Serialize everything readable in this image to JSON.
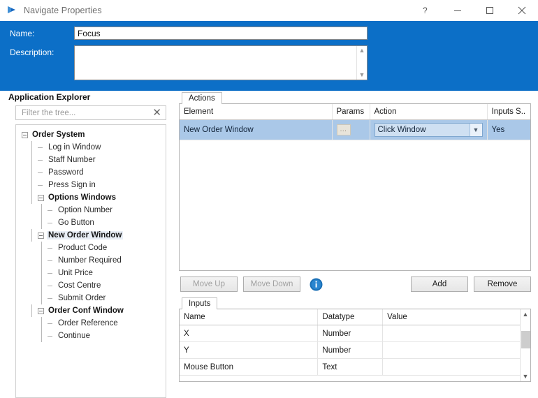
{
  "window": {
    "title": "Navigate Properties",
    "logo_icon": "play-triangle-icon",
    "controls": [
      {
        "name": "help",
        "glyph": "?"
      },
      {
        "name": "minimize",
        "glyph": "—"
      },
      {
        "name": "maximize",
        "glyph": "□"
      },
      {
        "name": "close",
        "glyph": "×"
      }
    ],
    "header_color": "#0c6fc7"
  },
  "form": {
    "name_label": "Name:",
    "name_value": "Focus",
    "description_label": "Description:",
    "description_value": "",
    "description_placeholder": ""
  },
  "explorer": {
    "title": "Application Explorer",
    "filter_placeholder": "Filter the tree...",
    "filter_value": "",
    "clear_icon": "✕",
    "tree": [
      {
        "label": "Order System",
        "depth": 0,
        "expander": true,
        "bold": true,
        "highlight": false
      },
      {
        "label": "Log in Window",
        "depth": 1,
        "expander": false,
        "bold": false,
        "highlight": false
      },
      {
        "label": "Staff Number",
        "depth": 1,
        "expander": false,
        "bold": false,
        "highlight": false
      },
      {
        "label": "Password",
        "depth": 1,
        "expander": false,
        "bold": false,
        "highlight": false
      },
      {
        "label": "Press Sign in",
        "depth": 1,
        "expander": false,
        "bold": false,
        "highlight": false
      },
      {
        "label": "Options Windows",
        "depth": 1,
        "expander": true,
        "bold": true,
        "highlight": false
      },
      {
        "label": "Option Number",
        "depth": 2,
        "expander": false,
        "bold": false,
        "highlight": false
      },
      {
        "label": "Go Button",
        "depth": 2,
        "expander": false,
        "bold": false,
        "highlight": false
      },
      {
        "label": "New Order Window",
        "depth": 1,
        "expander": true,
        "bold": true,
        "highlight": true
      },
      {
        "label": "Product Code",
        "depth": 2,
        "expander": false,
        "bold": false,
        "highlight": false
      },
      {
        "label": "Number Required",
        "depth": 2,
        "expander": false,
        "bold": false,
        "highlight": false
      },
      {
        "label": "Unit Price",
        "depth": 2,
        "expander": false,
        "bold": false,
        "highlight": false
      },
      {
        "label": "Cost Centre",
        "depth": 2,
        "expander": false,
        "bold": false,
        "highlight": false
      },
      {
        "label": "Submit Order",
        "depth": 2,
        "expander": false,
        "bold": false,
        "highlight": false
      },
      {
        "label": "Order Conf Window",
        "depth": 1,
        "expander": true,
        "bold": true,
        "highlight": false
      },
      {
        "label": "Order Reference",
        "depth": 2,
        "expander": false,
        "bold": false,
        "highlight": false
      },
      {
        "label": "Continue",
        "depth": 2,
        "expander": false,
        "bold": false,
        "highlight": false
      }
    ]
  },
  "actions": {
    "tab_label": "Actions",
    "columns": [
      "Element",
      "Params",
      "Action",
      "Inputs S.."
    ],
    "rows": [
      {
        "element": "New Order Window",
        "params": "...",
        "action": "Click Window",
        "inputs_supplied": "Yes",
        "selected": true
      }
    ],
    "selection_color": "#aac8e8"
  },
  "toolbar": {
    "move_up_label": "Move Up",
    "move_down_label": "Move Down",
    "move_up_disabled": true,
    "move_down_disabled": true,
    "info_icon": "info-circle-icon",
    "add_label": "Add",
    "remove_label": "Remove"
  },
  "inputs": {
    "tab_label": "Inputs",
    "columns": [
      "Name",
      "Datatype",
      "Value"
    ],
    "rows": [
      {
        "name": "X",
        "datatype": "Number",
        "value": "",
        "color": "blue"
      },
      {
        "name": "Y",
        "datatype": "Number",
        "value": "",
        "color": "blue"
      },
      {
        "name": "Mouse Button",
        "datatype": "Text",
        "value": "",
        "color": "green"
      }
    ],
    "scroll_up_icon": "ⱏ",
    "scroll_down_icon": "ⱟ"
  }
}
